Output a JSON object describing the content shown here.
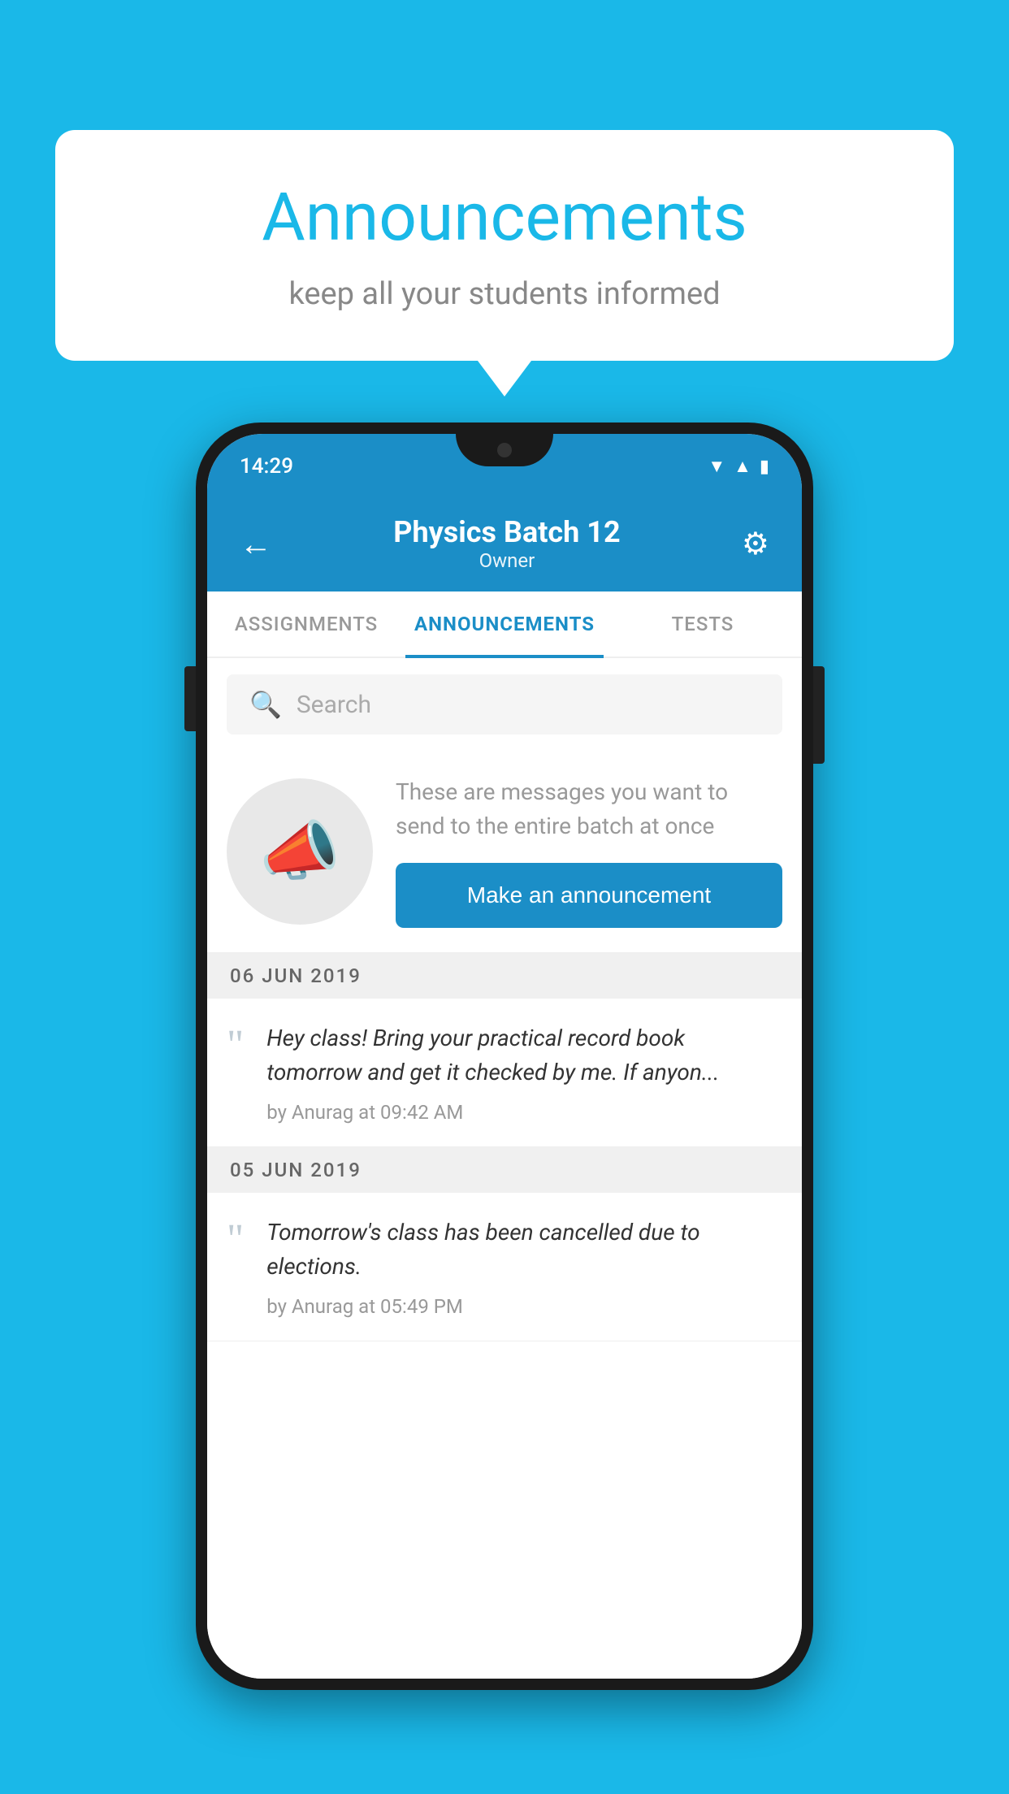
{
  "background_color": "#1ab8e8",
  "speech_bubble": {
    "title": "Announcements",
    "subtitle": "keep all your students informed"
  },
  "phone": {
    "status_bar": {
      "time": "14:29"
    },
    "header": {
      "title": "Physics Batch 12",
      "subtitle": "Owner",
      "back_label": "←",
      "gear_label": "⚙"
    },
    "tabs": [
      {
        "label": "ASSIGNMENTS",
        "active": false
      },
      {
        "label": "ANNOUNCEMENTS",
        "active": true
      },
      {
        "label": "TESTS",
        "active": false
      },
      {
        "label": "...",
        "active": false
      }
    ],
    "search": {
      "placeholder": "Search"
    },
    "empty_state": {
      "description": "These are messages you want to send to the entire batch at once",
      "cta": "Make an announcement"
    },
    "announcements": [
      {
        "date": "06  JUN  2019",
        "text": "Hey class! Bring your practical record book tomorrow and get it checked by me. If anyon...",
        "meta": "by Anurag at 09:42 AM"
      },
      {
        "date": "05  JUN  2019",
        "text": "Tomorrow's class has been cancelled due to elections.",
        "meta": "by Anurag at 05:49 PM"
      }
    ]
  }
}
